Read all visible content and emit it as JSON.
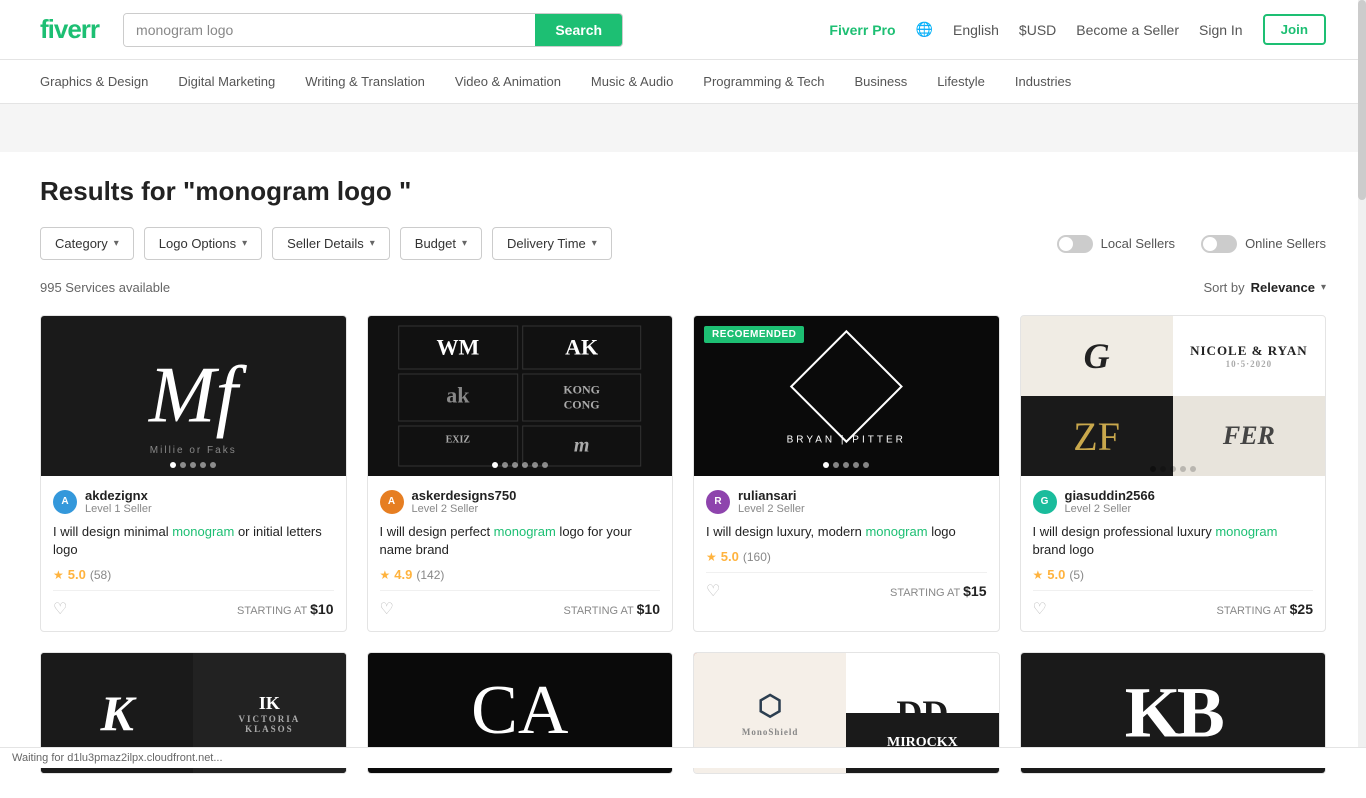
{
  "header": {
    "logo": "fiverr",
    "search_placeholder": "monogram logo",
    "search_button": "Search",
    "fiverr_pro": "Fiverr Pro",
    "language": "English",
    "currency": "$USD",
    "become_seller": "Become a Seller",
    "sign_in": "Sign In",
    "join": "Join"
  },
  "nav": {
    "items": [
      "Graphics & Design",
      "Digital Marketing",
      "Writing & Translation",
      "Video & Animation",
      "Music & Audio",
      "Programming & Tech",
      "Business",
      "Lifestyle",
      "Industries"
    ]
  },
  "filters": {
    "category": "Category",
    "logo_options": "Logo Options",
    "seller_details": "Seller Details",
    "budget": "Budget",
    "delivery_time": "Delivery Time",
    "local_sellers": "Local Sellers",
    "online_sellers": "Online Sellers"
  },
  "results": {
    "title": "Results for \"monogram logo \"",
    "count": "995 Services available",
    "sort_by": "Sort by",
    "sort_value": "Relevance"
  },
  "cards": [
    {
      "id": 1,
      "seller_name": "akdezignx",
      "seller_level": "Level 1 Seller",
      "title": "I will design minimal monogram or initial letters logo",
      "rating": "5.0",
      "reviews": "58",
      "starting_at": "STARTING AT",
      "price": "$10",
      "avatar_text": "A",
      "avatar_class": "av1"
    },
    {
      "id": 2,
      "seller_name": "askerdesigns750",
      "seller_level": "Level 2 Seller",
      "title": "I will design perfect monogram logo for your name brand",
      "rating": "4.9",
      "reviews": "142",
      "starting_at": "STARTING AT",
      "price": "$10",
      "avatar_text": "A",
      "avatar_class": "av2"
    },
    {
      "id": 3,
      "seller_name": "ruliansari",
      "seller_level": "Level 2 Seller",
      "title": "I will design luxury, modern monogram logo",
      "rating": "5.0",
      "reviews": "160",
      "starting_at": "STARTING AT",
      "price": "$15",
      "avatar_text": "R",
      "avatar_class": "av3",
      "recommended": true
    },
    {
      "id": 4,
      "seller_name": "giasuddin2566",
      "seller_level": "Level 2 Seller",
      "title": "I will design professional luxury monogram brand logo",
      "rating": "5.0",
      "reviews": "5",
      "starting_at": "STARTING AT",
      "price": "$25",
      "avatar_text": "G",
      "avatar_class": "av4"
    }
  ],
  "status_bar": {
    "text": "Waiting for d1lu3pmaz2ilpx.cloudfront.net..."
  }
}
